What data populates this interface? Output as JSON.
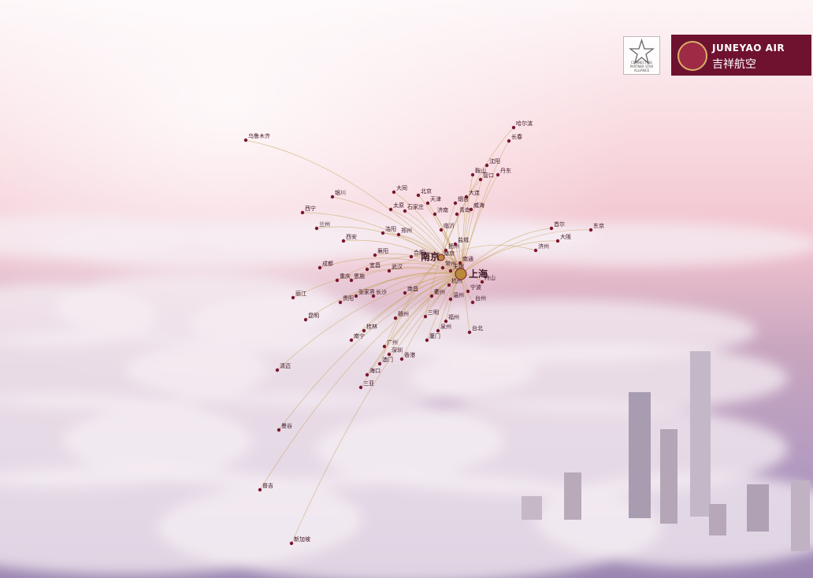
{
  "branding": {
    "alliance_text": "CONNECTING PARTNER STAR ALLIANCE",
    "airline_en": "JUNEYAO AIR",
    "airline_cn": "吉祥航空"
  },
  "hubs": [
    "上海",
    "南京"
  ],
  "cities": [
    "哈尔滨",
    "大连",
    "长春",
    "沈阳",
    "丹东",
    "营口",
    "鞍山",
    "北京",
    "天津",
    "石家庄",
    "烟台",
    "青岛",
    "威海",
    "济南",
    "临沂",
    "南京",
    "南通",
    "无锡",
    "常州",
    "扬州",
    "盐城",
    "合肥",
    "杭州",
    "宁波",
    "温州",
    "舟山",
    "台州",
    "衢州",
    "福州",
    "厦门",
    "泉州",
    "三明",
    "南昌",
    "赣州",
    "长沙",
    "张家界",
    "武汉",
    "宜昌",
    "恩施",
    "襄阳",
    "郑州",
    "洛阳",
    "太原",
    "大同",
    "西安",
    "银川",
    "兰州",
    "西宁",
    "乌鲁木齐",
    "海口",
    "三亚",
    "广州",
    "深圳",
    "桂林",
    "南宁",
    "成都",
    "重庆",
    "昆明",
    "贵阳",
    "丽江",
    "香港",
    "澳门",
    "台北",
    "大阪",
    "东京",
    "首尔",
    "济州",
    "曼谷",
    "清迈",
    "普吉",
    "新加坡"
  ],
  "network_colors": {
    "route": "#c4a35a",
    "dot": "#7a1730",
    "label": "#3e1524",
    "hub": "#b98a3a"
  }
}
